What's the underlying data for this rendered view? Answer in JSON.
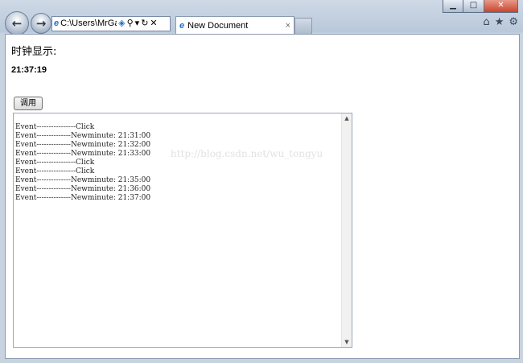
{
  "browser": {
    "address_text": "C:\\Users\\MrGa",
    "tab_title": "New Document",
    "window_buttons": {
      "minimize": "▁",
      "maximize": "□",
      "close": "✕"
    },
    "nav": {
      "back": "←",
      "forward": "→"
    },
    "icons": {
      "search": "⚲",
      "dropdown": "▾",
      "refresh": "↻",
      "stop": "✕",
      "home": "⌂",
      "favorites": "★",
      "tools": "⚙",
      "tab_close": "×",
      "ie": "e"
    }
  },
  "page": {
    "heading": "时钟显示:",
    "clock": "21:37:19",
    "call_button": "调用",
    "log_lines": [
      "Event----------------Click",
      "Event--------------Newminute: 21:31:00",
      "Event--------------Newminute: 21:32:00",
      "Event--------------Newminute: 21:33:00",
      "Event----------------Click",
      "Event----------------Click",
      "Event--------------Newminute: 21:35:00",
      "Event--------------Newminute: 21:36:00",
      "Event--------------Newminute: 21:37:00"
    ],
    "scroll_up": "▲",
    "scroll_down": "▼"
  },
  "watermark": "http://blog.csdn.net/wu_tongyu",
  "colors": {
    "window_frame": "#b9c8da",
    "ie_blue": "#1e6fc9"
  }
}
